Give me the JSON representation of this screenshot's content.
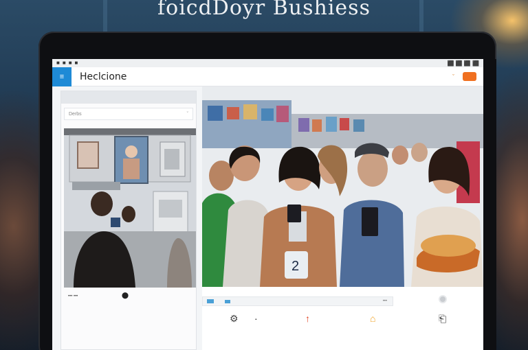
{
  "headline": "foicdDoyr Bushiess",
  "statusbar": {
    "left_icons": [
      "app-icon-1",
      "app-icon-2",
      "app-icon-3",
      "app-icon-4"
    ],
    "right_text": "⬛ ⬛ ⬛ ⬛"
  },
  "appbar": {
    "menu_glyph": "≡",
    "title": "Heclcione",
    "chevron": "ˇ"
  },
  "left_panel": {
    "dropdown_value": "Derbs",
    "dropdown_chevron": "ˇ",
    "caption": "••• •••",
    "pin_glyph": "⬤"
  },
  "right_panel": {
    "strip_end": "•••",
    "shirt_number": "2"
  },
  "toolbar": {
    "items": [
      {
        "icon": "globe-icon",
        "glyph": "⚙",
        "color": "#444444"
      },
      {
        "icon": "dot-icon",
        "glyph": "·",
        "color": "#222222"
      },
      {
        "icon": "pin-icon",
        "glyph": "↑",
        "color": "#e04020"
      },
      {
        "icon": "home-icon",
        "glyph": "⌂",
        "color": "#f0a020"
      },
      {
        "icon": "share-icon",
        "glyph": "⎗",
        "color": "#333333"
      }
    ]
  },
  "colors": {
    "accent_blue": "#1e8ad6",
    "accent_orange": "#f07020"
  }
}
